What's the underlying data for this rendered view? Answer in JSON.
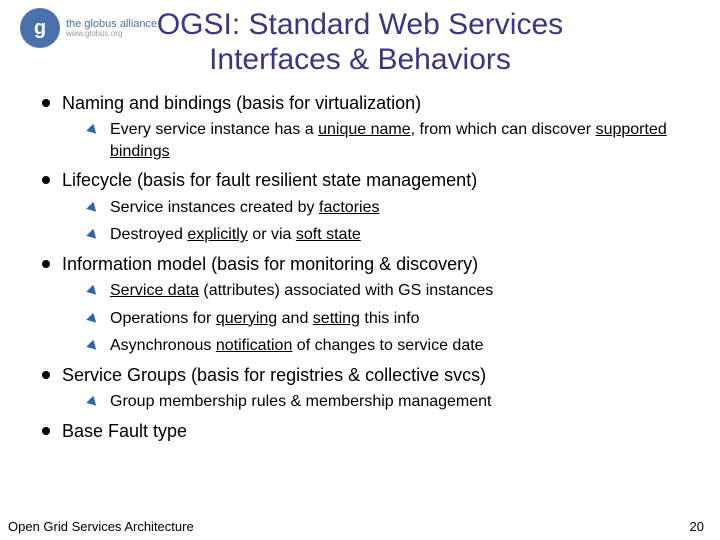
{
  "logo": {
    "glyph": "g",
    "line1": "the globus alliance",
    "line2": "www.globus.org"
  },
  "title_l1": "OGSI: Standard Web Services",
  "title_l2": "Interfaces & Behaviors",
  "items": [
    {
      "label": "Naming and bindings (basis for virtualization)",
      "sub": [
        {
          "html": "Every service instance has a <span class=\"u\">unique name</span>, from which can discover <span class=\"u\">supported bindings</span>"
        }
      ]
    },
    {
      "label": "Lifecycle (basis for fault resilient state management)",
      "sub": [
        {
          "html": "Service instances created by <span class=\"u\">factories</span>"
        },
        {
          "html": "Destroyed <span class=\"u\">explicitly</span> or via <span class=\"u\">soft state</span>"
        }
      ]
    },
    {
      "label": "Information model (basis for monitoring & discovery)",
      "sub": [
        {
          "html": "<span class=\"u\">Service data</span> (attributes) associated with GS instances"
        },
        {
          "html": "Operations for <span class=\"u\">querying</span> and <span class=\"u\">setting</span> this info"
        },
        {
          "html": "Asynchronous <span class=\"u\">notification</span> of changes to service date"
        }
      ]
    },
    {
      "label": "Service Groups (basis for registries & collective svcs)",
      "sub": [
        {
          "html": "Group membership rules & membership management"
        }
      ]
    },
    {
      "label": "Base Fault type",
      "sub": []
    }
  ],
  "footer": "Open Grid Services Architecture",
  "page_number": "20"
}
